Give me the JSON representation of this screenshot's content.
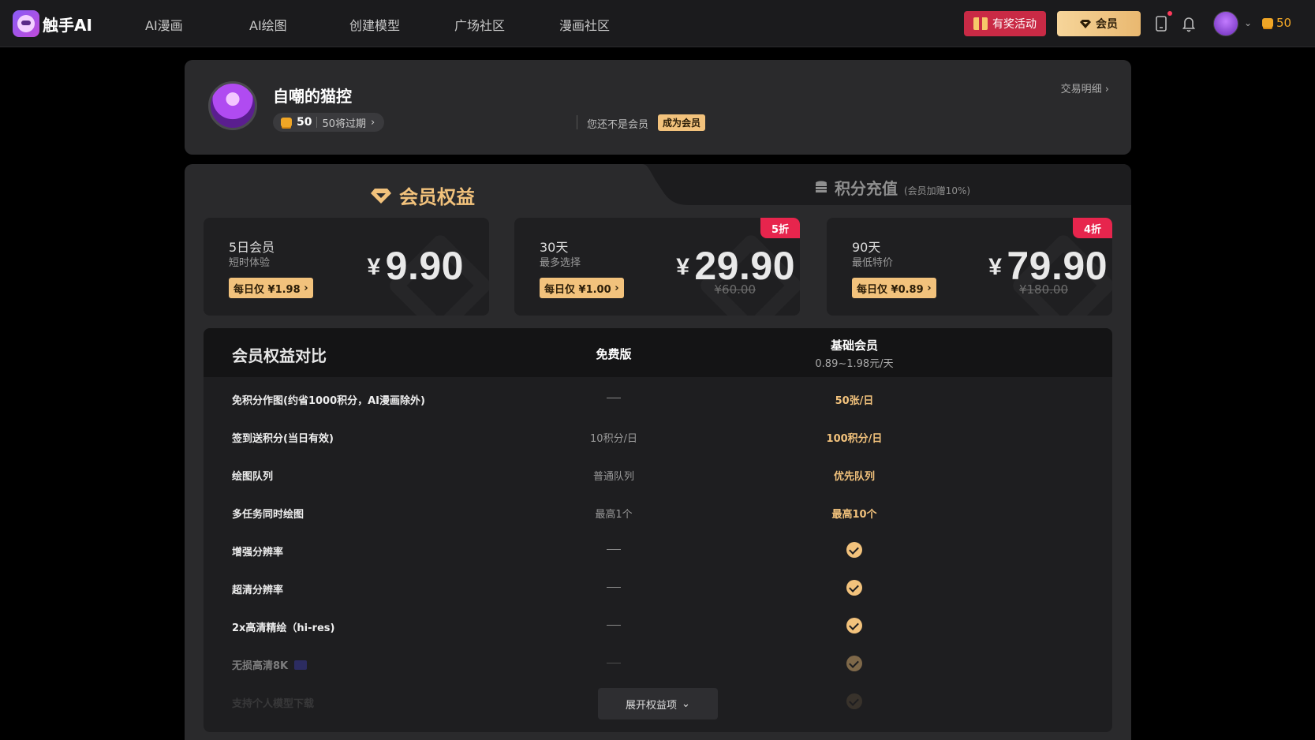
{
  "app": {
    "logo_text": "触手AI"
  },
  "nav": {
    "items": [
      "AI漫画",
      "AI绘图",
      "创建模型",
      "广场社区",
      "漫画社区"
    ]
  },
  "header": {
    "promo_label": "有奖活动",
    "vip_label": "会员",
    "points": "50"
  },
  "profile": {
    "name": "自嘲的猫控",
    "points": "50",
    "expire_text": "50将过期",
    "not_vip_text": "您还不是会员",
    "become_vip_label": "成为会员",
    "transactions_label": "交易明细"
  },
  "tabs": {
    "active": "会员权益",
    "inactive": "积分充值",
    "inactive_note": "(会员加赠10%)"
  },
  "plans": [
    {
      "name": "5日会员",
      "sub": "短时体验",
      "daily": "每日仅 ¥1.98",
      "currency": "¥",
      "price": "9.90",
      "original": "",
      "discount": ""
    },
    {
      "name": "30天",
      "sub": "最多选择",
      "daily": "每日仅 ¥1.00",
      "currency": "¥",
      "price": "29.90",
      "original": "¥60.00",
      "discount": "5折"
    },
    {
      "name": "90天",
      "sub": "最低特价",
      "daily": "每日仅 ¥0.89",
      "currency": "¥",
      "price": "79.90",
      "original": "¥180.00",
      "discount": "4折"
    }
  ],
  "compare": {
    "title": "会员权益对比",
    "free_header": "免费版",
    "vip_header": "基础会员",
    "vip_sub": "0.89~1.98元/天",
    "rows": [
      {
        "label": "免积分作图(约省1000积分，AI漫画除外)",
        "free": "",
        "vip": "50张/日"
      },
      {
        "label": "签到送积分(当日有效)",
        "free": "10积分/日",
        "vip": "100积分/日"
      },
      {
        "label": "绘图队列",
        "free": "普通队列",
        "vip": "优先队列"
      },
      {
        "label": "多任务同时绘图",
        "free": "最高1个",
        "vip": "最高10个"
      },
      {
        "label": "增强分辨率",
        "free": "",
        "vip": ""
      },
      {
        "label": "超清分辨率",
        "free": "",
        "vip": ""
      },
      {
        "label": "2x高清精绘（hi-res)",
        "free": "",
        "vip": ""
      },
      {
        "label": "无损高清8K",
        "free": "",
        "vip": ""
      },
      {
        "label": "支持个人模型下载",
        "free": "",
        "vip": ""
      }
    ],
    "expand_label": "展开权益项"
  },
  "colors": {
    "accent_gold": "#f2c27c",
    "discount_red": "#e7254d",
    "promo_red": "#c92a45",
    "coin": "#f0a626"
  }
}
